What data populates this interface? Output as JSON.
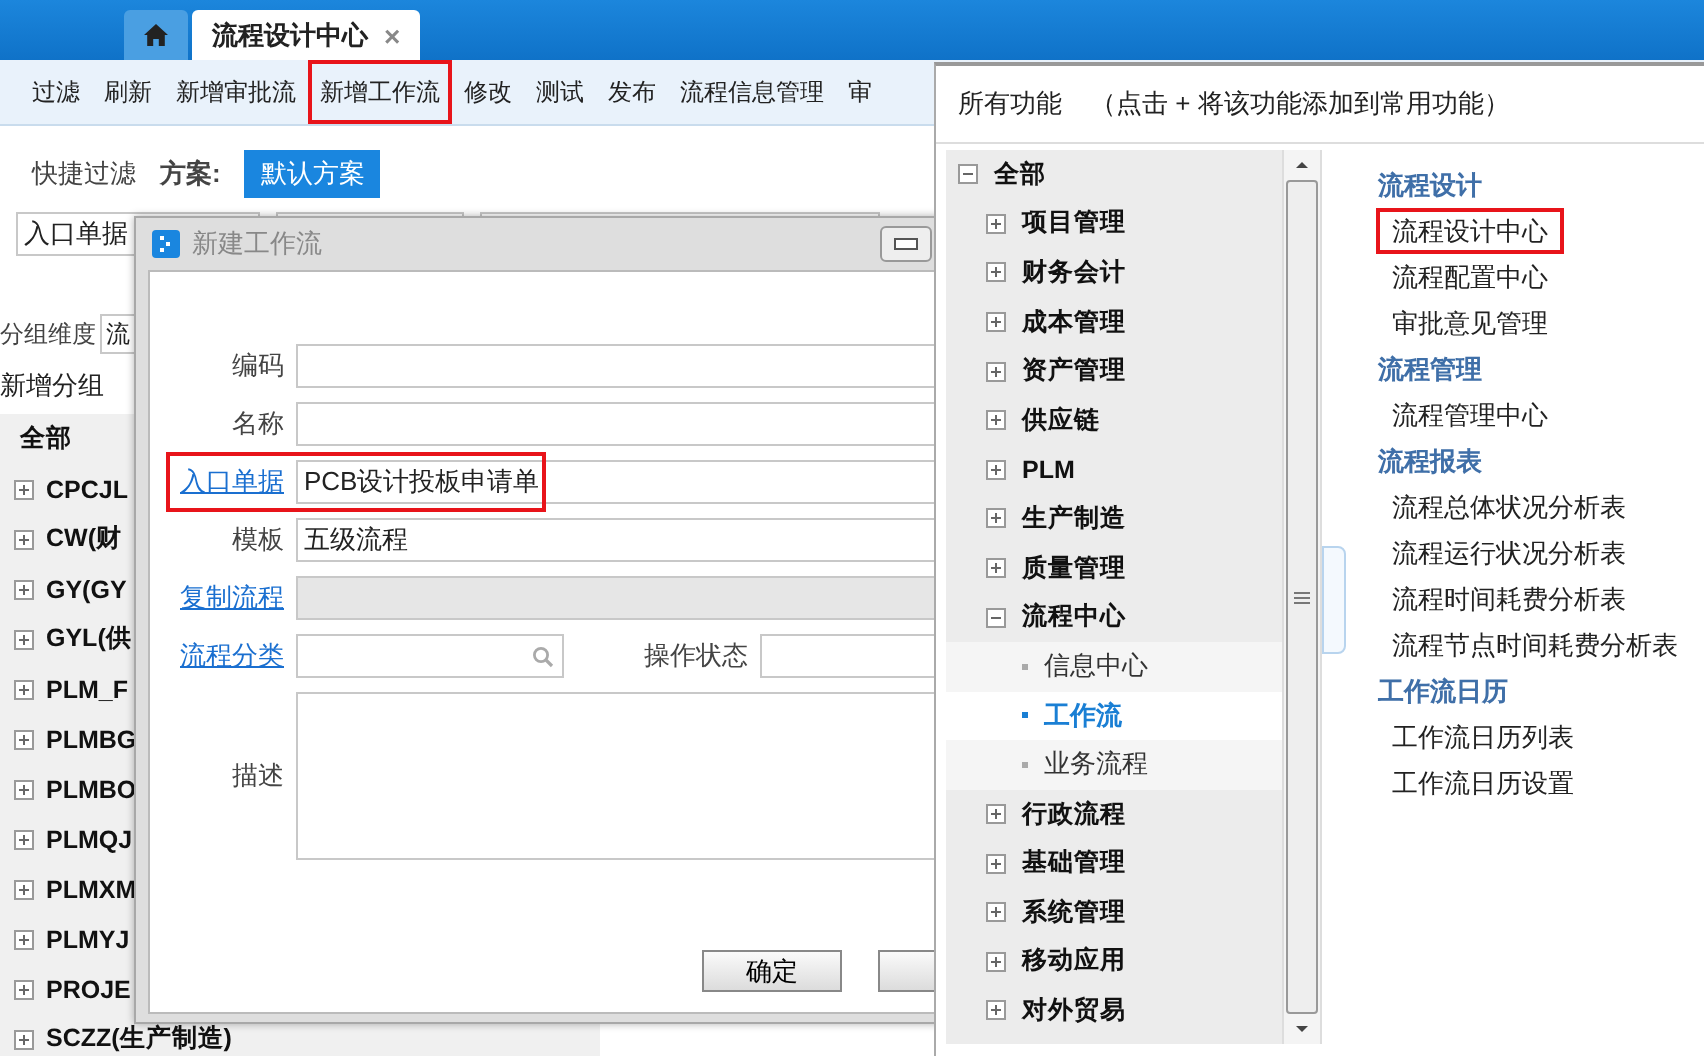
{
  "tabs": [
    {
      "kind": "home",
      "selected": false
    },
    {
      "kind": "page",
      "label": "流程设计中心",
      "close": "×",
      "selected": true
    }
  ],
  "toolbar": [
    {
      "label": "过滤",
      "highlighted": false
    },
    {
      "label": "刷新",
      "highlighted": false
    },
    {
      "label": "新增审批流",
      "highlighted": false
    },
    {
      "label": "新增工作流",
      "highlighted": true
    },
    {
      "label": "修改",
      "highlighted": false
    },
    {
      "label": "测试",
      "highlighted": false
    },
    {
      "label": "发布",
      "highlighted": false
    },
    {
      "label": "流程信息管理",
      "highlighted": false
    },
    {
      "label": "审",
      "highlighted": false
    }
  ],
  "quick_filter": {
    "label": "快捷过滤",
    "scheme_label": "方案:",
    "scheme": "默认方案"
  },
  "filter_field": {
    "value": "入口单据"
  },
  "group_by": {
    "label": "分组维度",
    "value": "流"
  },
  "group_actions": [
    "新增分组"
  ],
  "tree": {
    "label": "全部",
    "children": [
      {
        "label": "CPCJL",
        "expanded": false
      },
      {
        "label": "CW(财",
        "expanded": false
      },
      {
        "label": "GY(GY",
        "expanded": false
      },
      {
        "label": "GYL(供",
        "expanded": false
      },
      {
        "label": "PLM_F",
        "expanded": false
      },
      {
        "label": "PLMBG",
        "expanded": false
      },
      {
        "label": "PLMBO",
        "expanded": false
      },
      {
        "label": "PLMQJ",
        "expanded": false
      },
      {
        "label": "PLMXM",
        "expanded": false
      },
      {
        "label": "PLMYJ",
        "expanded": false
      },
      {
        "label": "PROJE",
        "expanded": false
      },
      {
        "label": "SCZZ(生产制造)",
        "expanded": false
      }
    ]
  },
  "dialog": {
    "title": "新建工作流",
    "fields": [
      {
        "kind": "text",
        "label": "编码",
        "link": false,
        "disabled": false,
        "highlighted": false
      },
      {
        "kind": "text",
        "label": "名称",
        "link": false,
        "disabled": false,
        "highlighted": false
      },
      {
        "kind": "text",
        "label": "入口单据",
        "link": true,
        "disabled": false,
        "highlighted": true,
        "value": "PCB设计投板申请单"
      },
      {
        "kind": "text",
        "label": "模板",
        "link": false,
        "disabled": false,
        "highlighted": false,
        "value": "五级流程"
      },
      {
        "kind": "text",
        "label": "复制流程",
        "link": true,
        "disabled": true,
        "highlighted": false
      },
      {
        "kind": "lookup",
        "label": "流程分类",
        "link": true,
        "disabled": false,
        "highlighted": false,
        "extra_label": "操作状态"
      },
      {
        "kind": "textarea",
        "label": "描述",
        "link": false,
        "disabled": false,
        "highlighted": false
      }
    ],
    "buttons": [
      "确定"
    ]
  },
  "menu": {
    "title": "所有功能",
    "hint": "（点击 + 将该功能添加到常用功能）",
    "tree": {
      "label": "全部",
      "expanded": true,
      "children": [
        {
          "label": "项目管理",
          "expanded": false
        },
        {
          "label": "财务会计",
          "expanded": false
        },
        {
          "label": "成本管理",
          "expanded": false
        },
        {
          "label": "资产管理",
          "expanded": false
        },
        {
          "label": "供应链",
          "expanded": false
        },
        {
          "label": "PLM",
          "expanded": false
        },
        {
          "label": "生产制造",
          "expanded": false
        },
        {
          "label": "质量管理",
          "expanded": false
        },
        {
          "label": "流程中心",
          "expanded": true,
          "children": [
            {
              "label": "信息中心",
              "selected": false
            },
            {
              "label": "工作流",
              "selected": true
            },
            {
              "label": "业务流程",
              "selected": false
            }
          ]
        },
        {
          "label": "行政流程",
          "expanded": false
        },
        {
          "label": "基础管理",
          "expanded": false
        },
        {
          "label": "系统管理",
          "expanded": false
        },
        {
          "label": "移动应用",
          "expanded": false
        },
        {
          "label": "对外贸易",
          "expanded": false
        }
      ]
    },
    "groups": [
      {
        "heading": "流程设计",
        "items": [
          {
            "label": "流程设计中心",
            "highlighted": true
          },
          {
            "label": "流程配置中心",
            "highlighted": false
          },
          {
            "label": "审批意见管理",
            "highlighted": false
          }
        ]
      },
      {
        "heading": "流程管理",
        "items": [
          {
            "label": "流程管理中心",
            "highlighted": false
          }
        ]
      },
      {
        "heading": "流程报表",
        "items": [
          {
            "label": "流程总体状况分析表",
            "highlighted": false
          },
          {
            "label": "流程运行状况分析表",
            "highlighted": false
          },
          {
            "label": "流程时间耗费分析表",
            "highlighted": false
          },
          {
            "label": "流程节点时间耗费分析表",
            "highlighted": false
          }
        ]
      },
      {
        "heading": "工作流日历",
        "items": [
          {
            "label": "工作流日历列表",
            "highlighted": false
          },
          {
            "label": "工作流日历设置",
            "highlighted": false
          }
        ]
      }
    ]
  }
}
